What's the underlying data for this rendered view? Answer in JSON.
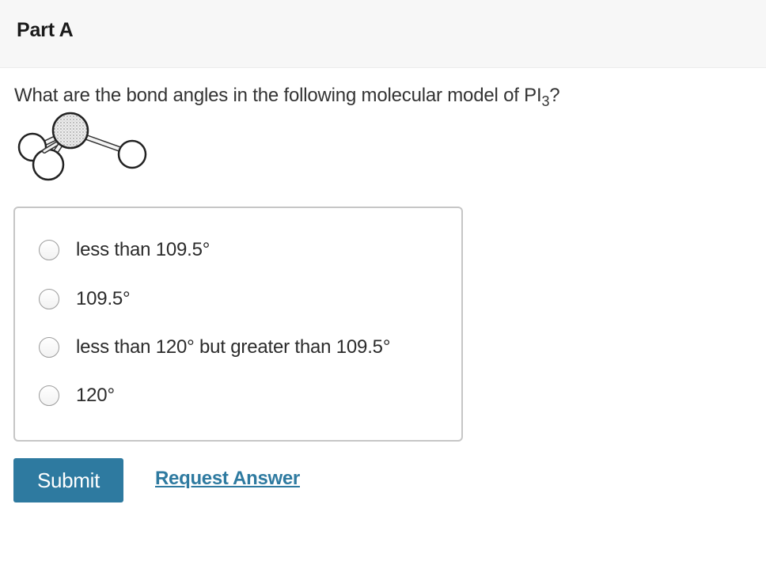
{
  "part": {
    "title": "Part A"
  },
  "question": {
    "text_before": "What are the bond angles in the following molecular model of PI",
    "subscript": "3",
    "text_after": "?"
  },
  "molecule_image": {
    "icon": "pi3-molecular-model"
  },
  "choices": [
    {
      "label": "less than 109.5°",
      "selected": false
    },
    {
      "label": "109.5°",
      "selected": false
    },
    {
      "label": "less than 120° but greater than 109.5°",
      "selected": false
    },
    {
      "label": "120°",
      "selected": false
    }
  ],
  "actions": {
    "submit_label": "Submit",
    "request_answer_label": "Request Answer"
  },
  "colors": {
    "accent": "#2e7aa0",
    "header_bg": "#f7f7f7",
    "border": "#c6c6c6"
  }
}
